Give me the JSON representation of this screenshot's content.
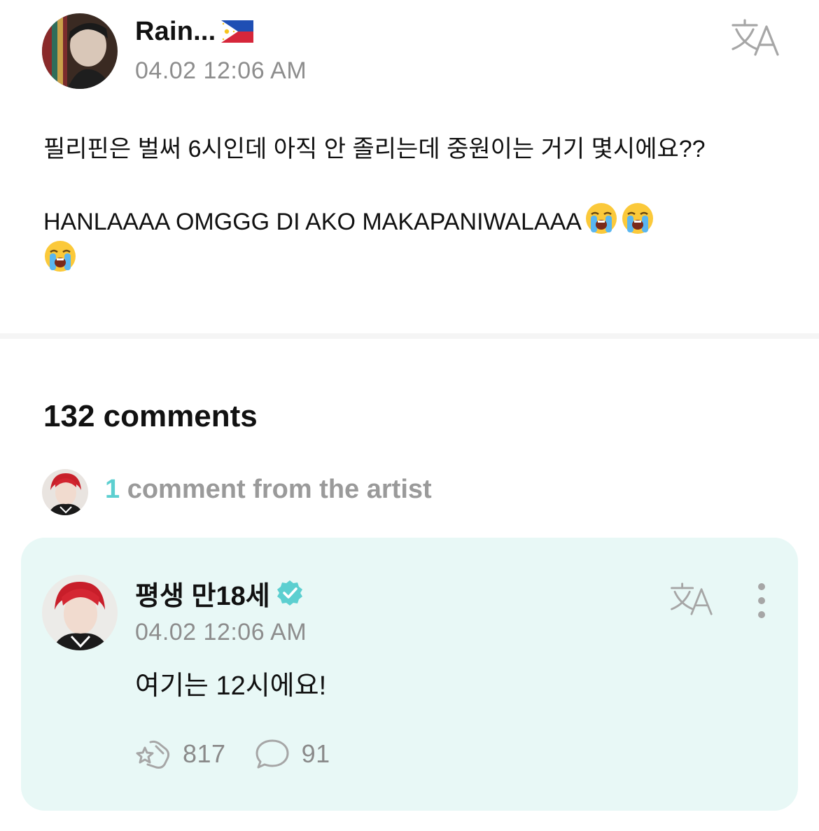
{
  "post": {
    "author": "Rain...",
    "author_flag": "philippines-flag",
    "timestamp": "04.02 12:06 AM",
    "translate_icon": "translate-icon",
    "text_line1": "필리핀은 벌써 6시인데 아직 안 졸리는데 중원이는 거기 몇시에요??",
    "text_line2": "HANLAAAA OMGGG DI AKO MAKAPANIWALAAA",
    "emoji": "loudly-crying-face-emoji"
  },
  "comments": {
    "count_label": "132 comments",
    "artist_count": "1",
    "artist_label": "comment from the artist"
  },
  "artist_comment": {
    "author": "평생 만18세",
    "verified_icon": "verified-badge-icon",
    "timestamp": "04.02 12:06 AM",
    "text": "여기는 12시에요!",
    "likes": "817",
    "replies": "91",
    "like_icon": "cheer-icon",
    "reply_icon": "speech-bubble-icon",
    "more_icon": "more-vertical-icon"
  },
  "colors": {
    "accent": "#5ccfd0",
    "card_bg": "#e8f8f6",
    "muted": "#8d8d8d"
  }
}
